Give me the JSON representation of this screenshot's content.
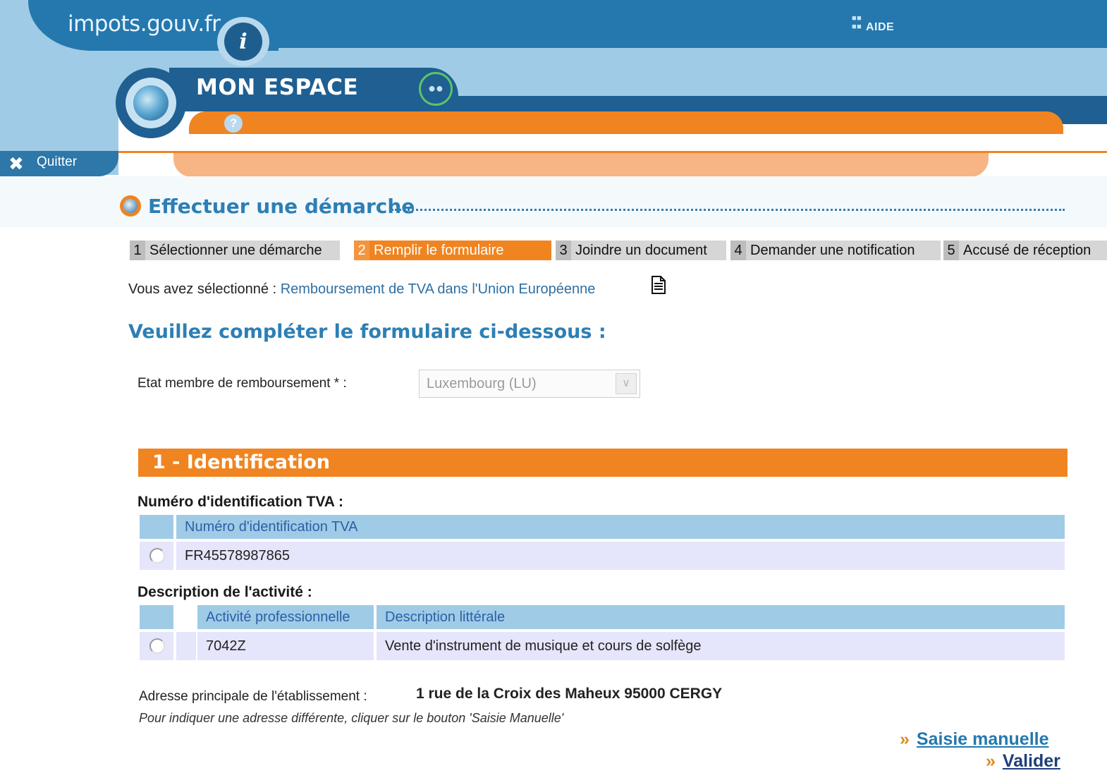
{
  "header": {
    "brand": "impots.gouv.fr",
    "brand_logo_glyph": "i",
    "aide": "AIDE",
    "espace_title": "MON ESPACE",
    "help_glyph": "?",
    "quitter": "Quitter"
  },
  "page": {
    "title": "Effectuer une démarche",
    "steps": [
      {
        "num": "1",
        "label": "Sélectionner une démarche",
        "active": false
      },
      {
        "num": "2",
        "label": "Remplir le formulaire",
        "active": true
      },
      {
        "num": "3",
        "label": "Joindre un document",
        "active": false
      },
      {
        "num": "4",
        "label": "Demander une notification",
        "active": false
      },
      {
        "num": "5",
        "label": "Accusé de réception",
        "active": false
      }
    ],
    "selection_prefix": "Vous avez sélectionné : ",
    "selection_value": "Remboursement de TVA dans l'Union Européenne",
    "form_heading": "Veuillez compléter le formulaire ci-dessous :"
  },
  "etat": {
    "label": "Etat membre de remboursement * :",
    "selected": "Luxembourg (LU)"
  },
  "identification": {
    "section_title": "1 - Identification",
    "tva_label": "Numéro d'identification TVA :",
    "tva_table": {
      "header": "Numéro d'identification TVA",
      "rows": [
        "FR45578987865"
      ]
    },
    "activity_label": "Description de l'activité :",
    "activity_table": {
      "headers": [
        "Activité professionnelle",
        "Description littérale"
      ],
      "rows": [
        [
          "7042Z",
          "Vente d'instrument de musique et cours de solfège"
        ]
      ]
    },
    "address_label": "Adresse principale de l'établissement :",
    "address_value": "1 rue de la Croix des Maheux 95000 CERGY",
    "address_hint": "Pour indiquer une adresse différente, cliquer sur le bouton 'Saisie Manuelle'"
  },
  "actions": {
    "saisie": "Saisie manuelle",
    "valider": "Valider"
  },
  "colors": {
    "header_blue": "#2478ae",
    "light_blue": "#9fcbe6",
    "orange": "#f08421",
    "title_blue": "#2d7fb5"
  }
}
